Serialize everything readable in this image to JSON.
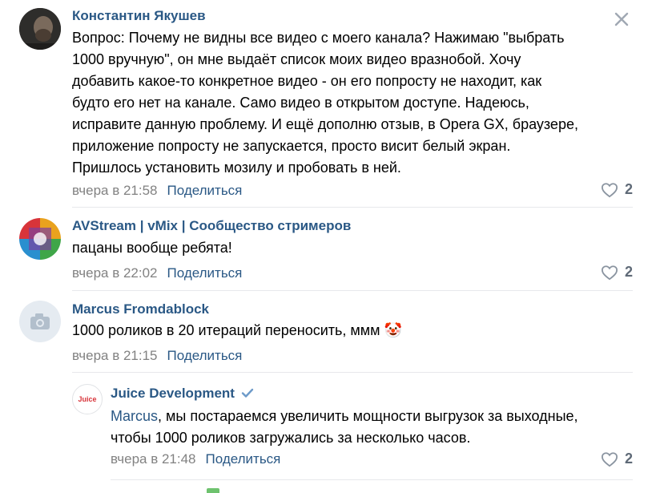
{
  "comments": [
    {
      "author": "Константин Якушев",
      "text": "Вопрос: Почему не видны все видео с моего канала? Нажимаю \"выбрать 1000 вручную\", он мне выдаёт список моих видео вразнобой. Хочу добавить какое-то конкретное видео - он его попросту не находит, как будто его нет на канале. Само видео в открытом доступе. Надеюсь, исправите данную проблему. И ещё дополню отзыв, в Opera GX, браузере, приложение попросту не запускается, просто висит белый экран. Пришлось установить мозилу и пробовать в ней.",
      "lines": [
        "Вопрос: Почему не видны все видео с моего канала? Нажимаю \"выбрать",
        "1000 вручную\", он мне выдаёт список моих видео вразнобой. Хочу",
        "добавить какое-то конкретное видео - он его попросту не находит, как",
        "будто его нет на канале. Само видео в открытом доступе. Надеюсь,",
        "исправите данную проблему. И ещё дополню отзыв, в Opera GX, браузере,",
        "приложение попросту не запускается, просто висит белый экран.",
        "Пришлось установить мозилу и пробовать в ней."
      ],
      "time": "вчера в 21:58",
      "share": "Поделиться",
      "likes": "2"
    },
    {
      "author": "AVStream | vMix | Сообщество стримеров",
      "text": "пацаны вообще ребята!",
      "time": "вчера в 22:02",
      "share": "Поделиться",
      "likes": "2"
    },
    {
      "author": "Marcus Fromdablock",
      "text": "1000 роликов в 20 итераций переносить, ммм",
      "emoji": "🤡",
      "time": "вчера в 21:15",
      "share": "Поделиться"
    }
  ],
  "reply": {
    "author": "Juice Development",
    "avatar_text": "Juice",
    "mention": "Marcus",
    "text_line1": ", мы постараемся увеличить мощности выгрузок за выходные,",
    "text_line2": "чтобы 1000 роликов загружались за несколько часов.",
    "time": "вчера в 21:48",
    "share": "Поделиться",
    "likes": "2"
  },
  "colors": {
    "link": "#2a5885",
    "meta": "#828282",
    "divider": "#e7e8ec"
  },
  "icons": [
    "close-icon",
    "heart-icon",
    "camera-icon",
    "verified-icon"
  ]
}
